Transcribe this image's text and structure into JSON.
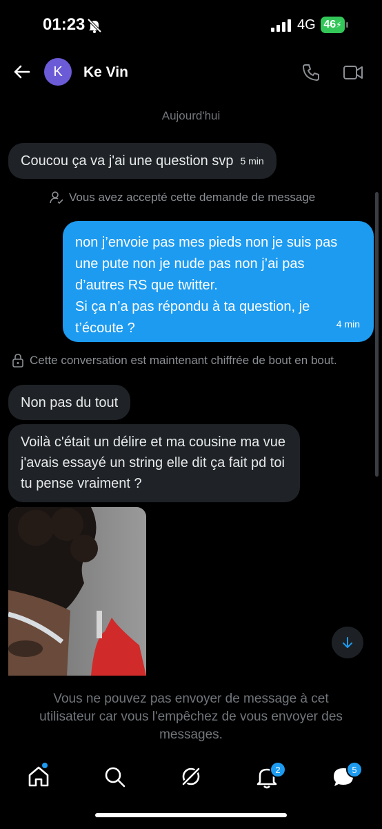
{
  "status_bar": {
    "time": "01:23",
    "network": "4G",
    "battery": "46"
  },
  "header": {
    "avatar_initial": "K",
    "contact_name": "Ke Vin"
  },
  "conversation": {
    "day_label": "Aujourd'hui",
    "msg1": {
      "text": "Coucou ça va j'ai une question svp",
      "time": "5 min"
    },
    "system1": "Vous avez accepté cette demande de message",
    "msg2": {
      "lines": [
        "non j’envoie pas mes pieds non je suis pas",
        "une pute non je nude pas non j’ai pas",
        "d’autres RS que twitter.",
        "Si ça n’a pas répondu à ta question, je",
        "t’écoute ?"
      ],
      "time": "4 min"
    },
    "system2": "Cette conversation est maintenant chiffrée de bout en bout.",
    "msg3": {
      "text": "Non pas du tout"
    },
    "msg4": {
      "lines": [
        "Voilà c'était un délire et ma cousine ma vue",
        "j'avais essayé un string elle dit ça fait pd toi",
        "tu pense vraiment ?"
      ]
    }
  },
  "footer": {
    "blocked_lines": [
      "Vous ne pouvez pas envoyer de message à cet",
      "utilisateur car vous l'empêchez de vous envoyer des",
      "messages."
    ]
  },
  "nav": {
    "notifications_badge": "2",
    "messages_badge": "5"
  },
  "colors": {
    "accent": "#1d9bf0",
    "bubble_in": "#1f2226",
    "avatar": "#6b5bd6"
  }
}
